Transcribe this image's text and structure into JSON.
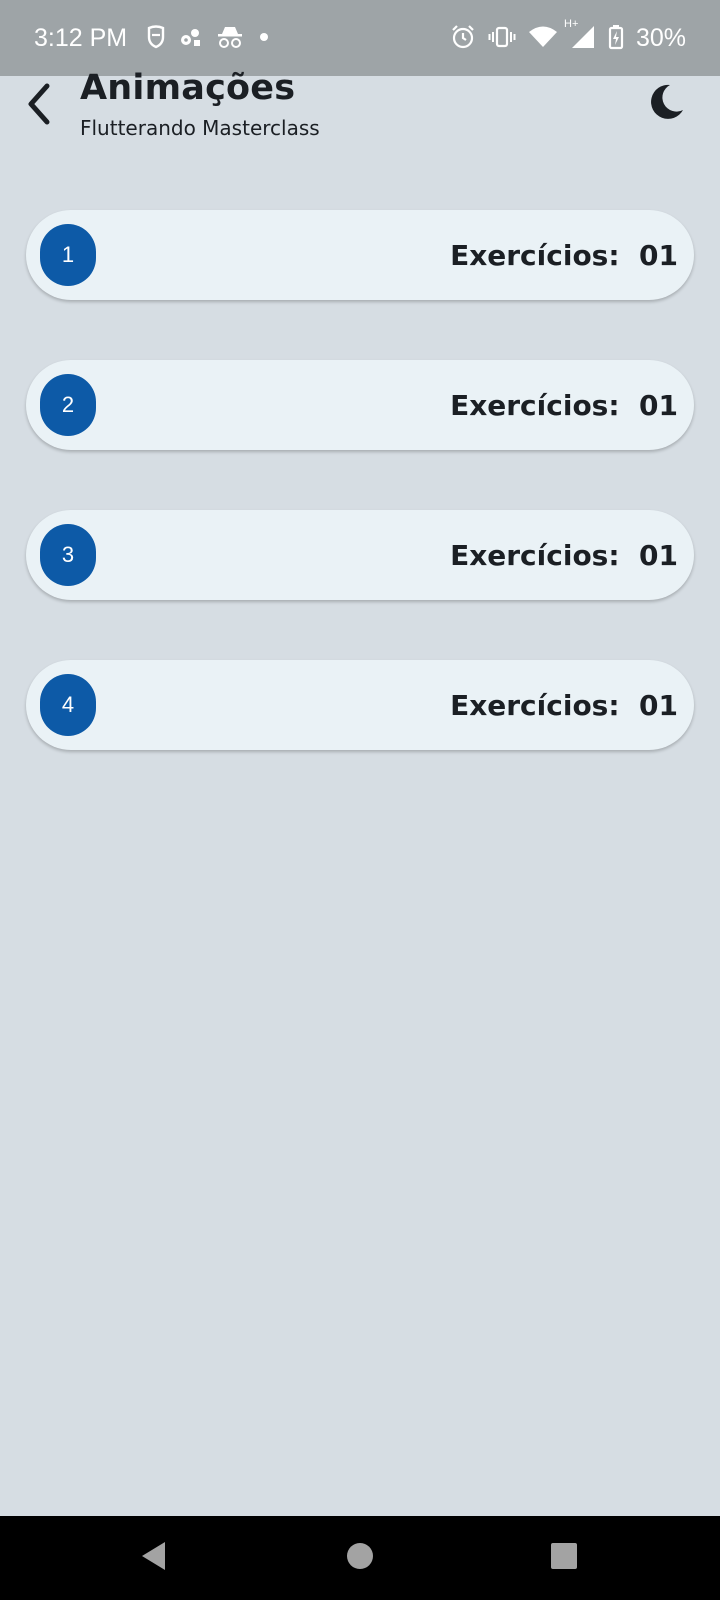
{
  "status_bar": {
    "time": "3:12 PM",
    "left_icons": [
      "shield-icon",
      "puzzle-icon",
      "incognito-icon",
      "notification-dot-icon"
    ],
    "right_icons": [
      "alarm-icon",
      "vibrate-icon",
      "wifi-icon",
      "mobile-signal-icon",
      "battery-charging-icon"
    ],
    "network_type": "H+",
    "battery": "30%"
  },
  "app_bar": {
    "title": "Animações",
    "subtitle": "Flutterando Masterclass",
    "back_icon": "back-arrow-icon",
    "theme_icon": "moon-icon"
  },
  "modules": [
    {
      "number": "1",
      "label": "Exercícios:  01"
    },
    {
      "number": "2",
      "label": "Exercícios:  01"
    },
    {
      "number": "3",
      "label": "Exercícios:  01"
    },
    {
      "number": "4",
      "label": "Exercícios:  01"
    }
  ],
  "nav_bar": {
    "icons": [
      "nav-back-icon",
      "nav-home-icon",
      "nav-recents-icon"
    ]
  },
  "colors": {
    "background": "#d6dde3",
    "card": "#eaf2f6",
    "badge": "#0d5aa7",
    "status_bar": "#9ea4a7"
  }
}
